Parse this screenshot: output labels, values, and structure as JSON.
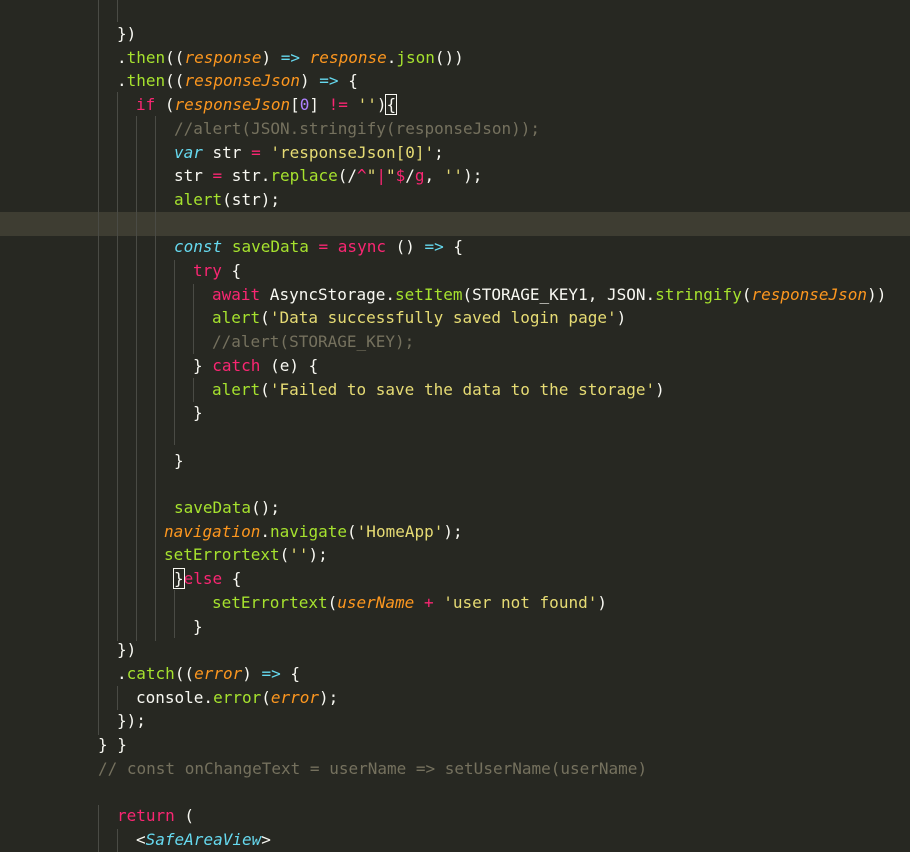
{
  "editor": {
    "lines": [
      [
        {
          "t": "})",
          "c": "plain"
        }
      ],
      [
        {
          "t": ".",
          "c": "plain"
        },
        {
          "t": "then",
          "c": "fn"
        },
        {
          "t": "((",
          "c": "plain"
        },
        {
          "t": "response",
          "c": "param"
        },
        {
          "t": ") ",
          "c": "plain"
        },
        {
          "t": "=>",
          "c": "decl"
        },
        {
          "t": " ",
          "c": "plain"
        },
        {
          "t": "response",
          "c": "param"
        },
        {
          "t": ".",
          "c": "plain"
        },
        {
          "t": "json",
          "c": "fn"
        },
        {
          "t": "())",
          "c": "plain"
        }
      ],
      [
        {
          "t": ".",
          "c": "plain"
        },
        {
          "t": "then",
          "c": "fn"
        },
        {
          "t": "((",
          "c": "plain"
        },
        {
          "t": "responseJson",
          "c": "param"
        },
        {
          "t": ") ",
          "c": "plain"
        },
        {
          "t": "=>",
          "c": "decl"
        },
        {
          "t": " {",
          "c": "plain"
        }
      ],
      [
        {
          "t": "if",
          "c": "kw"
        },
        {
          "t": " (",
          "c": "plain"
        },
        {
          "t": "responseJson",
          "c": "param"
        },
        {
          "t": "[",
          "c": "plain"
        },
        {
          "t": "0",
          "c": "num"
        },
        {
          "t": "] ",
          "c": "plain"
        },
        {
          "t": "!=",
          "c": "op"
        },
        {
          "t": " ",
          "c": "plain"
        },
        {
          "t": "''",
          "c": "str"
        },
        {
          "t": ")",
          "c": "plain"
        },
        {
          "t": "{",
          "c": "bracket-hl"
        }
      ],
      [
        {
          "t": "//alert(JSON.stringify(responseJson));",
          "c": "comment"
        }
      ],
      [
        {
          "t": "var",
          "c": "decl"
        },
        {
          "t": " str ",
          "c": "plain"
        },
        {
          "t": "=",
          "c": "op"
        },
        {
          "t": " ",
          "c": "plain"
        },
        {
          "t": "'responseJson[0]'",
          "c": "str"
        },
        {
          "t": ";",
          "c": "plain"
        }
      ],
      [
        {
          "t": "str ",
          "c": "plain"
        },
        {
          "t": "=",
          "c": "op"
        },
        {
          "t": " str.",
          "c": "plain"
        },
        {
          "t": "replace",
          "c": "fn"
        },
        {
          "t": "(/",
          "c": "plain"
        },
        {
          "t": "^",
          "c": "op"
        },
        {
          "t": "\"",
          "c": "str"
        },
        {
          "t": "|",
          "c": "op"
        },
        {
          "t": "\"",
          "c": "str"
        },
        {
          "t": "$",
          "c": "op"
        },
        {
          "t": "/",
          "c": "plain"
        },
        {
          "t": "g",
          "c": "kw"
        },
        {
          "t": ", ",
          "c": "plain"
        },
        {
          "t": "''",
          "c": "str"
        },
        {
          "t": ");",
          "c": "plain"
        }
      ],
      [
        {
          "t": "alert",
          "c": "fn"
        },
        {
          "t": "(str);",
          "c": "plain"
        }
      ],
      [],
      [
        {
          "t": "const",
          "c": "decl"
        },
        {
          "t": " ",
          "c": "plain"
        },
        {
          "t": "saveData",
          "c": "fn"
        },
        {
          "t": " ",
          "c": "plain"
        },
        {
          "t": "=",
          "c": "op"
        },
        {
          "t": " ",
          "c": "plain"
        },
        {
          "t": "async",
          "c": "kw"
        },
        {
          "t": " () ",
          "c": "plain"
        },
        {
          "t": "=>",
          "c": "decl"
        },
        {
          "t": " {",
          "c": "plain"
        }
      ],
      [
        {
          "t": "try",
          "c": "kw"
        },
        {
          "t": " {",
          "c": "plain"
        }
      ],
      [
        {
          "t": "await",
          "c": "kw"
        },
        {
          "t": " AsyncStorage.",
          "c": "plain"
        },
        {
          "t": "setItem",
          "c": "fn"
        },
        {
          "t": "(STORAGE_KEY1, JSON.",
          "c": "plain"
        },
        {
          "t": "stringify",
          "c": "fn"
        },
        {
          "t": "(",
          "c": "plain"
        },
        {
          "t": "responseJson",
          "c": "param"
        },
        {
          "t": "))",
          "c": "plain"
        }
      ],
      [
        {
          "t": "alert",
          "c": "fn"
        },
        {
          "t": "(",
          "c": "plain"
        },
        {
          "t": "'Data successfully saved login page'",
          "c": "str"
        },
        {
          "t": ")",
          "c": "plain"
        }
      ],
      [
        {
          "t": "//alert(STORAGE_KEY);",
          "c": "comment"
        }
      ],
      [
        {
          "t": "} ",
          "c": "plain"
        },
        {
          "t": "catch",
          "c": "kw"
        },
        {
          "t": " (e) {",
          "c": "plain"
        }
      ],
      [
        {
          "t": "alert",
          "c": "fn"
        },
        {
          "t": "(",
          "c": "plain"
        },
        {
          "t": "'Failed to save the data to the storage'",
          "c": "str"
        },
        {
          "t": ")",
          "c": "plain"
        }
      ],
      [
        {
          "t": "}",
          "c": "plain"
        }
      ],
      [],
      [
        {
          "t": "}",
          "c": "plain"
        }
      ],
      [],
      [
        {
          "t": "saveData",
          "c": "fn"
        },
        {
          "t": "();",
          "c": "plain"
        }
      ],
      [
        {
          "t": "navigation",
          "c": "param"
        },
        {
          "t": ".",
          "c": "plain"
        },
        {
          "t": "navigate",
          "c": "fn"
        },
        {
          "t": "(",
          "c": "plain"
        },
        {
          "t": "'HomeApp'",
          "c": "str"
        },
        {
          "t": ");",
          "c": "plain"
        }
      ],
      [
        {
          "t": "setErrortext",
          "c": "fn"
        },
        {
          "t": "(",
          "c": "plain"
        },
        {
          "t": "''",
          "c": "str"
        },
        {
          "t": ");",
          "c": "plain"
        }
      ],
      [
        {
          "t": "}",
          "c": "bracket-hl"
        },
        {
          "t": "else",
          "c": "kw"
        },
        {
          "t": " {",
          "c": "plain"
        }
      ],
      [
        {
          "t": "setErrortext",
          "c": "fn"
        },
        {
          "t": "(",
          "c": "plain"
        },
        {
          "t": "userName",
          "c": "param"
        },
        {
          "t": " ",
          "c": "plain"
        },
        {
          "t": "+",
          "c": "op"
        },
        {
          "t": " ",
          "c": "plain"
        },
        {
          "t": "'user not found'",
          "c": "str"
        },
        {
          "t": ")",
          "c": "plain"
        }
      ],
      [
        {
          "t": "}",
          "c": "plain"
        }
      ],
      [
        {
          "t": "})",
          "c": "plain"
        }
      ],
      [
        {
          "t": ".",
          "c": "plain"
        },
        {
          "t": "catch",
          "c": "fn"
        },
        {
          "t": "((",
          "c": "plain"
        },
        {
          "t": "error",
          "c": "param"
        },
        {
          "t": ") ",
          "c": "plain"
        },
        {
          "t": "=>",
          "c": "decl"
        },
        {
          "t": " {",
          "c": "plain"
        }
      ],
      [
        {
          "t": "console.",
          "c": "plain"
        },
        {
          "t": "error",
          "c": "fn"
        },
        {
          "t": "(",
          "c": "plain"
        },
        {
          "t": "error",
          "c": "param"
        },
        {
          "t": ");",
          "c": "plain"
        }
      ],
      [
        {
          "t": "});",
          "c": "plain"
        }
      ],
      [
        {
          "t": "} }",
          "c": "plain"
        }
      ],
      [
        {
          "t": "// const onChangeText = userName => setUserName(userName)",
          "c": "comment"
        }
      ],
      [],
      [
        {
          "t": "return",
          "c": "kw"
        },
        {
          "t": " (",
          "c": "plain"
        }
      ],
      [
        {
          "t": "<",
          "c": "plain"
        },
        {
          "t": "SafeAreaView",
          "c": "tag"
        },
        {
          "t": ">",
          "c": "plain"
        }
      ]
    ]
  },
  "theme": {
    "background": "#272822",
    "current_line": "#3e3d32",
    "keyword": "#f92672",
    "function": "#a6e22e",
    "string": "#e6db74",
    "parameter": "#fd971f",
    "comment": "#75715e",
    "storage": "#66d9ef",
    "number": "#ae81ff"
  }
}
